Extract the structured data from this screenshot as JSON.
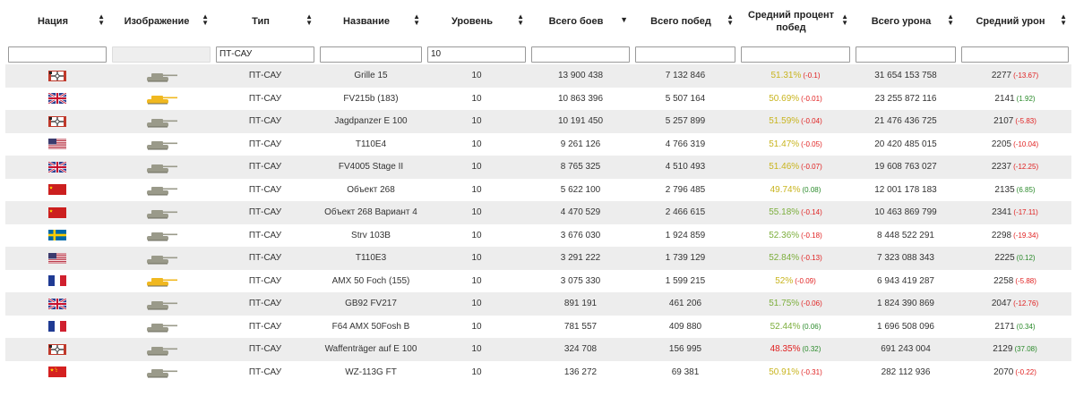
{
  "columns": [
    {
      "label": "Нация",
      "sort": "updown"
    },
    {
      "label": "Изображение",
      "sort": "updown"
    },
    {
      "label": "Тип",
      "sort": "updown"
    },
    {
      "label": "Название",
      "sort": "updown"
    },
    {
      "label": "Уровень",
      "sort": "updown"
    },
    {
      "label": "Всего боев",
      "sort": "down"
    },
    {
      "label": "Всего побед",
      "sort": "updown"
    },
    {
      "label": "Средний процент побед",
      "sort": "updown"
    },
    {
      "label": "Всего урона",
      "sort": "updown"
    },
    {
      "label": "Средний урон",
      "sort": "updown"
    }
  ],
  "filters": [
    "",
    "",
    "ПТ-САУ",
    "",
    "10",
    "",
    "",
    "",
    "",
    ""
  ],
  "colors": {
    "win_green": "#7cae3c",
    "win_yellow": "#c8b41e",
    "win_red": "#e02020",
    "neg": "#e02020",
    "pos": "#2a8a2a"
  },
  "rows": [
    {
      "nation": "germany",
      "tank_color": "gray",
      "type": "ПТ-САУ",
      "name": "Grille 15",
      "level": "10",
      "battles": "13 900 438",
      "wins": "7 132 846",
      "win_rate": "51.31%",
      "win_rate_color": "yellow",
      "win_delta": "(-0.1)",
      "win_delta_sign": "neg",
      "damage": "31 654 153 758",
      "avg_damage": "2277",
      "dmg_delta": "(-13.67)",
      "dmg_delta_sign": "neg"
    },
    {
      "nation": "uk",
      "tank_color": "gold",
      "type": "ПТ-САУ",
      "name": "FV215b (183)",
      "level": "10",
      "battles": "10 863 396",
      "wins": "5 507 164",
      "win_rate": "50.69%",
      "win_rate_color": "yellow",
      "win_delta": "(-0.01)",
      "win_delta_sign": "neg",
      "damage": "23 255 872 116",
      "avg_damage": "2141",
      "dmg_delta": "(1.92)",
      "dmg_delta_sign": "pos"
    },
    {
      "nation": "germany",
      "tank_color": "gray",
      "type": "ПТ-САУ",
      "name": "Jagdpanzer E 100",
      "level": "10",
      "battles": "10 191 450",
      "wins": "5 257 899",
      "win_rate": "51.59%",
      "win_rate_color": "yellow",
      "win_delta": "(-0.04)",
      "win_delta_sign": "neg",
      "damage": "21 476 436 725",
      "avg_damage": "2107",
      "dmg_delta": "(-5.83)",
      "dmg_delta_sign": "neg"
    },
    {
      "nation": "usa",
      "tank_color": "gray",
      "type": "ПТ-САУ",
      "name": "T110E4",
      "level": "10",
      "battles": "9 261 126",
      "wins": "4 766 319",
      "win_rate": "51.47%",
      "win_rate_color": "yellow",
      "win_delta": "(-0.05)",
      "win_delta_sign": "neg",
      "damage": "20 420 485 015",
      "avg_damage": "2205",
      "dmg_delta": "(-10.04)",
      "dmg_delta_sign": "neg"
    },
    {
      "nation": "uk",
      "tank_color": "gray",
      "type": "ПТ-САУ",
      "name": "FV4005 Stage II",
      "level": "10",
      "battles": "8 765 325",
      "wins": "4 510 493",
      "win_rate": "51.46%",
      "win_rate_color": "yellow",
      "win_delta": "(-0.07)",
      "win_delta_sign": "neg",
      "damage": "19 608 763 027",
      "avg_damage": "2237",
      "dmg_delta": "(-12.25)",
      "dmg_delta_sign": "neg"
    },
    {
      "nation": "ussr",
      "tank_color": "gray",
      "type": "ПТ-САУ",
      "name": "Объект 268",
      "level": "10",
      "battles": "5 622 100",
      "wins": "2 796 485",
      "win_rate": "49.74%",
      "win_rate_color": "yellow",
      "win_delta": "(0.08)",
      "win_delta_sign": "pos",
      "damage": "12 001 178 183",
      "avg_damage": "2135",
      "dmg_delta": "(6.85)",
      "dmg_delta_sign": "pos"
    },
    {
      "nation": "ussr",
      "tank_color": "gray",
      "type": "ПТ-САУ",
      "name": "Объект 268 Вариант 4",
      "level": "10",
      "battles": "4 470 529",
      "wins": "2 466 615",
      "win_rate": "55.18%",
      "win_rate_color": "green",
      "win_delta": "(-0.14)",
      "win_delta_sign": "neg",
      "damage": "10 463 869 799",
      "avg_damage": "2341",
      "dmg_delta": "(-17.11)",
      "dmg_delta_sign": "neg"
    },
    {
      "nation": "sweden",
      "tank_color": "gray",
      "type": "ПТ-САУ",
      "name": "Strv 103B",
      "level": "10",
      "battles": "3 676 030",
      "wins": "1 924 859",
      "win_rate": "52.36%",
      "win_rate_color": "green",
      "win_delta": "(-0.18)",
      "win_delta_sign": "neg",
      "damage": "8 448 522 291",
      "avg_damage": "2298",
      "dmg_delta": "(-19.34)",
      "dmg_delta_sign": "neg"
    },
    {
      "nation": "usa",
      "tank_color": "gray",
      "type": "ПТ-САУ",
      "name": "T110E3",
      "level": "10",
      "battles": "3 291 222",
      "wins": "1 739 129",
      "win_rate": "52.84%",
      "win_rate_color": "green",
      "win_delta": "(-0.13)",
      "win_delta_sign": "neg",
      "damage": "7 323 088 343",
      "avg_damage": "2225",
      "dmg_delta": "(0.12)",
      "dmg_delta_sign": "pos"
    },
    {
      "nation": "france",
      "tank_color": "gold",
      "type": "ПТ-САУ",
      "name": "AMX 50 Foch (155)",
      "level": "10",
      "battles": "3 075 330",
      "wins": "1 599 215",
      "win_rate": "52%",
      "win_rate_color": "yellow",
      "win_delta": "(-0.09)",
      "win_delta_sign": "neg",
      "damage": "6 943 419 287",
      "avg_damage": "2258",
      "dmg_delta": "(-5.88)",
      "dmg_delta_sign": "neg"
    },
    {
      "nation": "uk",
      "tank_color": "gray",
      "type": "ПТ-САУ",
      "name": "GB92 FV217",
      "level": "10",
      "battles": "891 191",
      "wins": "461 206",
      "win_rate": "51.75%",
      "win_rate_color": "green",
      "win_delta": "(-0.06)",
      "win_delta_sign": "neg",
      "damage": "1 824 390 869",
      "avg_damage": "2047",
      "dmg_delta": "(-12.76)",
      "dmg_delta_sign": "neg"
    },
    {
      "nation": "france",
      "tank_color": "gray",
      "type": "ПТ-САУ",
      "name": "F64 AMX 50Fosh B",
      "level": "10",
      "battles": "781 557",
      "wins": "409 880",
      "win_rate": "52.44%",
      "win_rate_color": "green",
      "win_delta": "(0.06)",
      "win_delta_sign": "pos",
      "damage": "1 696 508 096",
      "avg_damage": "2171",
      "dmg_delta": "(0.34)",
      "dmg_delta_sign": "pos"
    },
    {
      "nation": "germany",
      "tank_color": "gray",
      "type": "ПТ-САУ",
      "name": "Waffenträger auf E 100",
      "level": "10",
      "battles": "324 708",
      "wins": "156 995",
      "win_rate": "48.35%",
      "win_rate_color": "red",
      "win_delta": "(0.32)",
      "win_delta_sign": "pos",
      "damage": "691 243 004",
      "avg_damage": "2129",
      "dmg_delta": "(37.08)",
      "dmg_delta_sign": "pos"
    },
    {
      "nation": "china",
      "tank_color": "gray",
      "type": "ПТ-САУ",
      "name": "WZ-113G FT",
      "level": "10",
      "battles": "136 272",
      "wins": "69 381",
      "win_rate": "50.91%",
      "win_rate_color": "yellow",
      "win_delta": "(-0.31)",
      "win_delta_sign": "neg",
      "damage": "282 112 936",
      "avg_damage": "2070",
      "dmg_delta": "(-0.22)",
      "dmg_delta_sign": "neg"
    }
  ]
}
